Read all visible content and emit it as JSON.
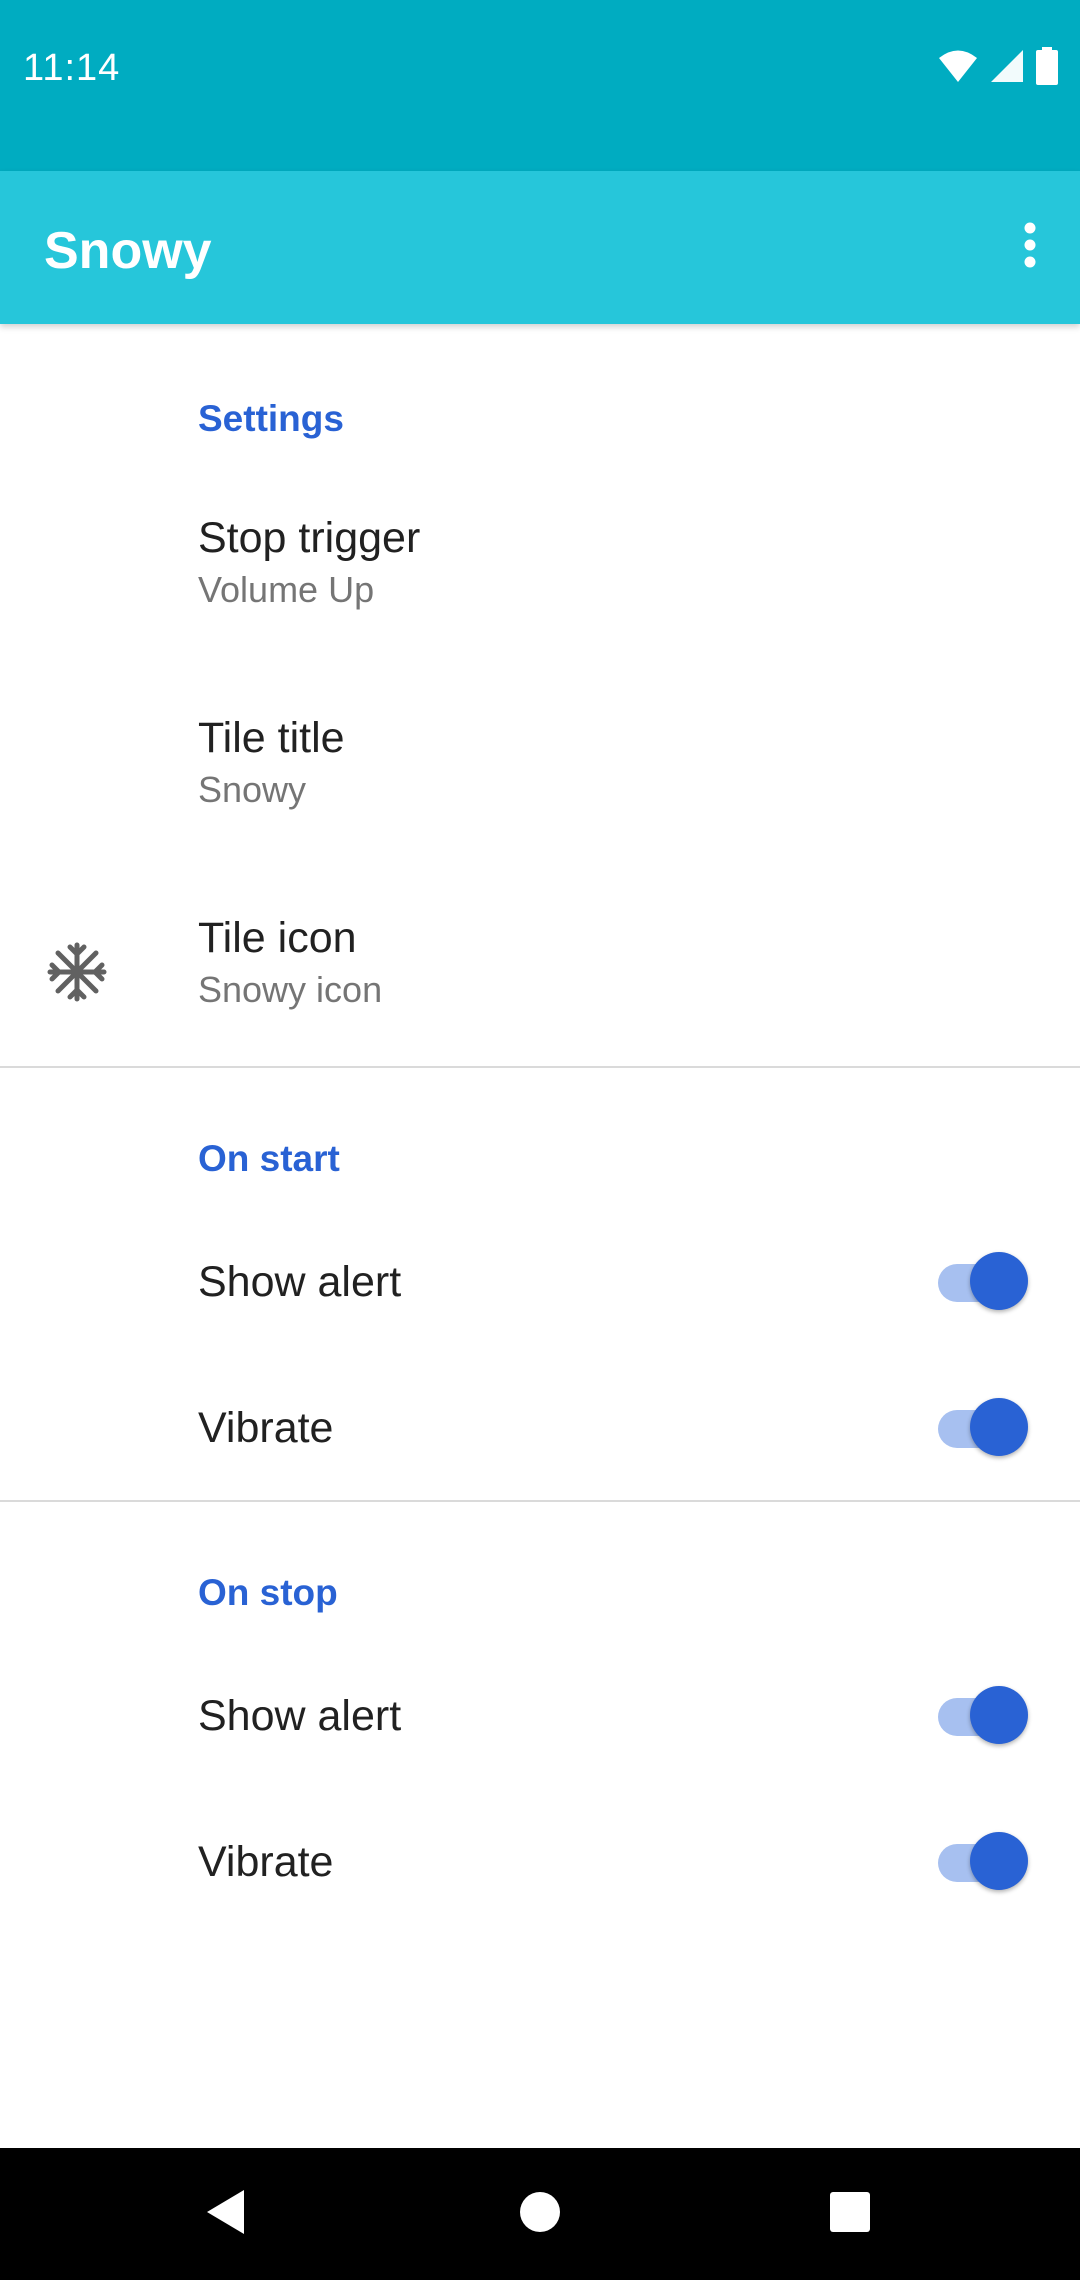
{
  "status_bar": {
    "time": "11:14",
    "icons": [
      "wifi-icon",
      "cell-signal-icon",
      "battery-icon"
    ],
    "background": "#00ACC1"
  },
  "app_bar": {
    "title": "Snowy",
    "background": "#26C6DA",
    "menu_icon": "more-vert-icon"
  },
  "sections": [
    {
      "header": "Settings",
      "items": [
        {
          "title": "Stop trigger",
          "summary": "Volume Up"
        },
        {
          "title": "Tile title",
          "summary": "Snowy"
        },
        {
          "title": "Tile icon",
          "summary": "Snowy icon",
          "icon": "snowflake-icon"
        }
      ]
    },
    {
      "header": "On start",
      "items": [
        {
          "title": "Show alert",
          "switch_on": true
        },
        {
          "title": "Vibrate",
          "switch_on": true
        }
      ]
    },
    {
      "header": "On stop",
      "items": [
        {
          "title": "Show alert",
          "switch_on": true
        },
        {
          "title": "Vibrate",
          "switch_on": true
        }
      ]
    }
  ],
  "colors": {
    "accent": "#2962D4",
    "switch_track": "#A7C0F0",
    "primary_text": "#212121",
    "secondary_text": "#757575"
  },
  "nav_bar": {
    "icons": [
      "back-icon",
      "home-icon",
      "recents-icon"
    ]
  }
}
